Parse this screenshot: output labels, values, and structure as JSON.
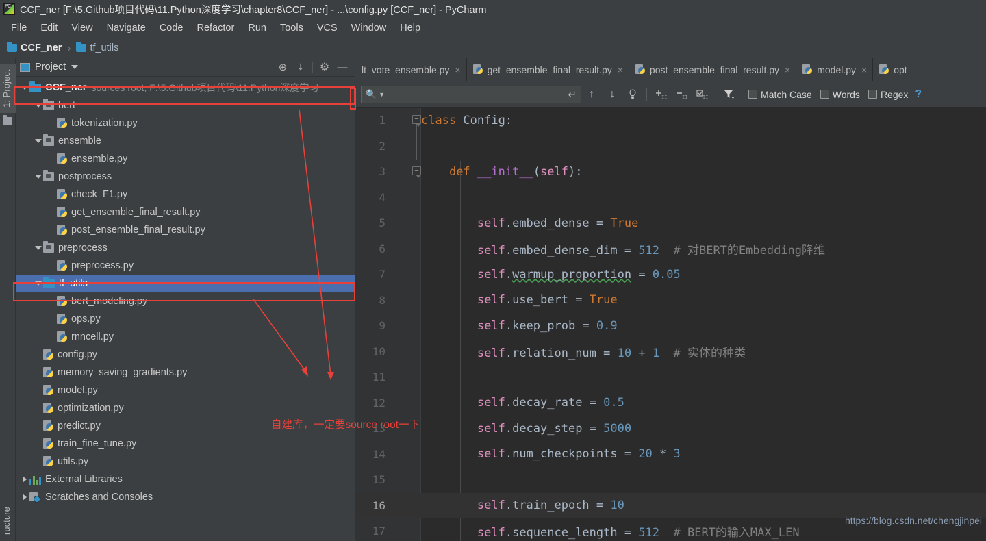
{
  "window": {
    "title": "CCF_ner [F:\\5.Github项目代码\\11.Python深度学习\\chapter8\\CCF_ner] - ...\\config.py [CCF_ner] - PyCharm",
    "app_icon": "pycharm-icon"
  },
  "menubar": {
    "items": [
      {
        "label": "File",
        "accel": "F"
      },
      {
        "label": "Edit",
        "accel": "E"
      },
      {
        "label": "View",
        "accel": "V"
      },
      {
        "label": "Navigate",
        "accel": "N"
      },
      {
        "label": "Code",
        "accel": "C"
      },
      {
        "label": "Refactor",
        "accel": "R"
      },
      {
        "label": "Run",
        "accel": "u"
      },
      {
        "label": "Tools",
        "accel": "T"
      },
      {
        "label": "VCS",
        "accel": "S"
      },
      {
        "label": "Window",
        "accel": "W"
      },
      {
        "label": "Help",
        "accel": "H"
      }
    ]
  },
  "breadcrumb": {
    "items": [
      {
        "label": "CCF_ner",
        "icon": "folder-icon",
        "bold": true
      },
      {
        "label": "tf_utils",
        "icon": "folder-icon",
        "bold": false
      }
    ],
    "separator": "›"
  },
  "left_strip": {
    "project_tab": "1: Project",
    "project_tab_accel": "1",
    "structure_tab": "ructure",
    "favorites_icon": "folder-icon"
  },
  "project_panel": {
    "title": "Project",
    "tools": [
      {
        "name": "locate-icon",
        "glyph": "⊕"
      },
      {
        "name": "collapse-all-icon",
        "glyph": "⤓"
      },
      {
        "name": "settings-gear-icon",
        "glyph": "⚙"
      },
      {
        "name": "hide-panel-icon",
        "glyph": "—"
      }
    ],
    "tree": [
      {
        "indent": 0,
        "arrow": "down",
        "icon": "root-folder-icon",
        "label": "CCF_ner",
        "bold": true,
        "meta": "sources root,  F:\\5.Github项目代码\\11.Python深度学习",
        "selected": false,
        "highlighted": true
      },
      {
        "indent": 1,
        "arrow": "down",
        "icon": "module-folder-icon",
        "label": "bert",
        "meta": "",
        "selected": false
      },
      {
        "indent": 2,
        "arrow": "none",
        "icon": "python-file-icon",
        "label": "tokenization.py",
        "meta": "",
        "selected": false
      },
      {
        "indent": 1,
        "arrow": "down",
        "icon": "module-folder-icon",
        "label": "ensemble",
        "meta": "",
        "selected": false
      },
      {
        "indent": 2,
        "arrow": "none",
        "icon": "python-file-icon",
        "label": "ensemble.py",
        "meta": "",
        "selected": false
      },
      {
        "indent": 1,
        "arrow": "down",
        "icon": "module-folder-icon",
        "label": "postprocess",
        "meta": "",
        "selected": false
      },
      {
        "indent": 2,
        "arrow": "none",
        "icon": "python-file-icon",
        "label": "check_F1.py",
        "meta": "",
        "selected": false
      },
      {
        "indent": 2,
        "arrow": "none",
        "icon": "python-file-icon",
        "label": "get_ensemble_final_result.py",
        "meta": "",
        "selected": false
      },
      {
        "indent": 2,
        "arrow": "none",
        "icon": "python-file-icon",
        "label": "post_ensemble_final_result.py",
        "meta": "",
        "selected": false
      },
      {
        "indent": 1,
        "arrow": "down",
        "icon": "module-folder-icon",
        "label": "preprocess",
        "meta": "",
        "selected": false
      },
      {
        "indent": 2,
        "arrow": "none",
        "icon": "python-file-icon",
        "label": "preprocess.py",
        "meta": "",
        "selected": false
      },
      {
        "indent": 1,
        "arrow": "down",
        "icon": "source-folder-icon",
        "label": "tf_utils",
        "meta": "",
        "selected": true,
        "highlighted": true
      },
      {
        "indent": 2,
        "arrow": "none",
        "icon": "python-file-icon",
        "label": "bert_modeling.py",
        "meta": "",
        "selected": false
      },
      {
        "indent": 2,
        "arrow": "none",
        "icon": "python-file-icon",
        "label": "ops.py",
        "meta": "",
        "selected": false
      },
      {
        "indent": 2,
        "arrow": "none",
        "icon": "python-file-icon",
        "label": "rnncell.py",
        "meta": "",
        "selected": false
      },
      {
        "indent": 1,
        "arrow": "none",
        "icon": "python-file-icon",
        "label": "config.py",
        "meta": "",
        "selected": false
      },
      {
        "indent": 1,
        "arrow": "none",
        "icon": "python-file-icon",
        "label": "memory_saving_gradients.py",
        "meta": "",
        "selected": false
      },
      {
        "indent": 1,
        "arrow": "none",
        "icon": "python-file-icon",
        "label": "model.py",
        "meta": "",
        "selected": false
      },
      {
        "indent": 1,
        "arrow": "none",
        "icon": "python-file-icon",
        "label": "optimization.py",
        "meta": "",
        "selected": false
      },
      {
        "indent": 1,
        "arrow": "none",
        "icon": "python-file-icon",
        "label": "predict.py",
        "meta": "",
        "selected": false
      },
      {
        "indent": 1,
        "arrow": "none",
        "icon": "python-file-icon",
        "label": "train_fine_tune.py",
        "meta": "",
        "selected": false
      },
      {
        "indent": 1,
        "arrow": "none",
        "icon": "python-file-icon",
        "label": "utils.py",
        "meta": "",
        "selected": false
      },
      {
        "indent": 0,
        "arrow": "right",
        "icon": "external-libraries-icon",
        "label": "External Libraries",
        "meta": "",
        "selected": false
      },
      {
        "indent": 0,
        "arrow": "right",
        "icon": "scratches-icon",
        "label": "Scratches and Consoles",
        "meta": "",
        "selected": false
      }
    ]
  },
  "editor_tabs": [
    {
      "label": "lt_vote_ensemble.py",
      "icon": "python-file-icon",
      "show_icon": false,
      "active": false,
      "close": "×"
    },
    {
      "label": "get_ensemble_final_result.py",
      "icon": "python-file-icon",
      "show_icon": true,
      "active": false,
      "close": "×"
    },
    {
      "label": "post_ensemble_final_result.py",
      "icon": "python-file-icon",
      "show_icon": true,
      "active": false,
      "close": "×"
    },
    {
      "label": "model.py",
      "icon": "python-file-icon",
      "show_icon": true,
      "active": false,
      "close": "×"
    },
    {
      "label": "opt",
      "icon": "python-file-icon",
      "show_icon": true,
      "active": false,
      "close": ""
    }
  ],
  "findbar": {
    "placeholder": "",
    "value": "",
    "search_icon": "magnifier-icon",
    "dropdown_icon": "chevron-down-icon",
    "enter_icon": "↵",
    "buttons": [
      {
        "name": "find-previous-icon",
        "glyph": "↑"
      },
      {
        "name": "find-next-icon",
        "glyph": "↓"
      },
      {
        "name": "select-all-occurrences-icon",
        "glyph": "⧉"
      },
      {
        "name": "add-line-icon",
        "glyph": "+"
      },
      {
        "name": "remove-line-icon",
        "glyph": "−"
      },
      {
        "name": "select-occurrence-icon",
        "glyph": "☑"
      },
      {
        "name": "filter-icon",
        "glyph": "▼"
      }
    ],
    "checkboxes": [
      {
        "label": "Match Case",
        "accel": "C",
        "checked": false
      },
      {
        "label": "Words",
        "accel": "o",
        "checked": false
      },
      {
        "label": "Regex",
        "accel": "x",
        "checked": false
      }
    ],
    "help": "?"
  },
  "code": {
    "language": "python",
    "lines": [
      {
        "n": "1",
        "highlight": false,
        "tokens": [
          {
            "t": "class ",
            "c": "kw"
          },
          {
            "t": "Config",
            "c": "cls"
          },
          {
            "t": ":",
            "c": "op"
          }
        ],
        "indent": 0
      },
      {
        "n": "2",
        "highlight": false,
        "tokens": [],
        "indent": 0
      },
      {
        "n": "3",
        "highlight": false,
        "tokens": [
          {
            "t": "    ",
            "c": "op"
          },
          {
            "t": "def ",
            "c": "kw"
          },
          {
            "t": "__init__",
            "c": "fn"
          },
          {
            "t": "(",
            "c": "op"
          },
          {
            "t": "self",
            "c": "selfk"
          },
          {
            "t": "):",
            "c": "op"
          }
        ],
        "indent": 0
      },
      {
        "n": "4",
        "highlight": false,
        "tokens": [],
        "indent": 1
      },
      {
        "n": "5",
        "highlight": false,
        "tokens": [
          {
            "t": "        ",
            "c": "op"
          },
          {
            "t": "self",
            "c": "selfk"
          },
          {
            "t": ".embed_dense = ",
            "c": "op"
          },
          {
            "t": "True",
            "c": "kw"
          }
        ],
        "indent": 1
      },
      {
        "n": "6",
        "highlight": false,
        "tokens": [
          {
            "t": "        ",
            "c": "op"
          },
          {
            "t": "self",
            "c": "selfk"
          },
          {
            "t": ".embed_dense_dim = ",
            "c": "op"
          },
          {
            "t": "512",
            "c": "num"
          },
          {
            "t": "  # 对BERT的Embedding降维",
            "c": "cmt"
          }
        ],
        "indent": 1
      },
      {
        "n": "7",
        "highlight": false,
        "tokens": [
          {
            "t": "        ",
            "c": "op"
          },
          {
            "t": "self",
            "c": "selfk"
          },
          {
            "t": ".",
            "c": "op"
          },
          {
            "t": "warmup_proportion",
            "c": "sq"
          },
          {
            "t": " = ",
            "c": "op"
          },
          {
            "t": "0.05",
            "c": "num"
          }
        ],
        "indent": 1
      },
      {
        "n": "8",
        "highlight": false,
        "tokens": [
          {
            "t": "        ",
            "c": "op"
          },
          {
            "t": "self",
            "c": "selfk"
          },
          {
            "t": ".use_bert = ",
            "c": "op"
          },
          {
            "t": "True",
            "c": "kw"
          }
        ],
        "indent": 1
      },
      {
        "n": "9",
        "highlight": false,
        "tokens": [
          {
            "t": "        ",
            "c": "op"
          },
          {
            "t": "self",
            "c": "selfk"
          },
          {
            "t": ".keep_prob = ",
            "c": "op"
          },
          {
            "t": "0.9",
            "c": "num"
          }
        ],
        "indent": 1
      },
      {
        "n": "10",
        "highlight": false,
        "tokens": [
          {
            "t": "        ",
            "c": "op"
          },
          {
            "t": "self",
            "c": "selfk"
          },
          {
            "t": ".relation_num = ",
            "c": "op"
          },
          {
            "t": "10",
            "c": "num"
          },
          {
            "t": " + ",
            "c": "op"
          },
          {
            "t": "1",
            "c": "num"
          },
          {
            "t": "  # 实体的种类",
            "c": "cmt"
          }
        ],
        "indent": 1
      },
      {
        "n": "11",
        "highlight": false,
        "tokens": [],
        "indent": 1
      },
      {
        "n": "12",
        "highlight": false,
        "tokens": [
          {
            "t": "        ",
            "c": "op"
          },
          {
            "t": "self",
            "c": "selfk"
          },
          {
            "t": ".decay_rate = ",
            "c": "op"
          },
          {
            "t": "0.5",
            "c": "num"
          }
        ],
        "indent": 1
      },
      {
        "n": "13",
        "highlight": false,
        "tokens": [
          {
            "t": "        ",
            "c": "op"
          },
          {
            "t": "self",
            "c": "selfk"
          },
          {
            "t": ".decay_step = ",
            "c": "op"
          },
          {
            "t": "5000",
            "c": "num"
          }
        ],
        "indent": 1
      },
      {
        "n": "14",
        "highlight": false,
        "tokens": [
          {
            "t": "        ",
            "c": "op"
          },
          {
            "t": "self",
            "c": "selfk"
          },
          {
            "t": ".num_checkpoints = ",
            "c": "op"
          },
          {
            "t": "20",
            "c": "num"
          },
          {
            "t": " * ",
            "c": "op"
          },
          {
            "t": "3",
            "c": "num"
          }
        ],
        "indent": 1
      },
      {
        "n": "15",
        "highlight": false,
        "tokens": [],
        "indent": 1
      },
      {
        "n": "16",
        "highlight": true,
        "tokens": [
          {
            "t": "        ",
            "c": "op"
          },
          {
            "t": "self",
            "c": "selfk"
          },
          {
            "t": ".train_epoch = ",
            "c": "op"
          },
          {
            "t": "10",
            "c": "num"
          }
        ],
        "indent": 1
      },
      {
        "n": "17",
        "highlight": false,
        "tokens": [
          {
            "t": "        ",
            "c": "op"
          },
          {
            "t": "self",
            "c": "selfk"
          },
          {
            "t": ".sequence_length = ",
            "c": "op"
          },
          {
            "t": "512",
            "c": "num"
          },
          {
            "t": "  # BERT的输入MAX_LEN",
            "c": "cmt"
          }
        ],
        "indent": 1
      }
    ]
  },
  "annotations": {
    "note": "自建库，一定要source root一下",
    "watermark": "https://blog.csdn.net/chengjinpei",
    "color": "#e8413a"
  }
}
